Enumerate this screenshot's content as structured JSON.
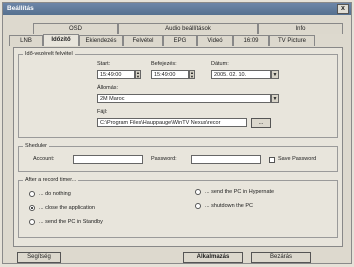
{
  "window": {
    "title": "Beállítás",
    "close_glyph": "x"
  },
  "tabs_top": [
    "OSD",
    "Audio beállítások",
    "Info"
  ],
  "tabs_bottom": [
    "LNB",
    "Időzítő",
    "Ekiendezés",
    "Felvétel",
    "EPG",
    "Videó",
    "16:09",
    "TV Picture"
  ],
  "timed": {
    "title": "Idő-vezérelt felvétel",
    "start_label": "Start:",
    "start_value": "15:49:00",
    "end_label": "Befejezés:",
    "end_value": "15:49:00",
    "date_label": "Dátum:",
    "date_value": "2005. 02. 10.",
    "station_label": "Állomás:",
    "station_value": "2M Maroc",
    "file_label": "Fájl:",
    "file_value": "C:\\Program Files\\Hauppauge\\WinTV Nexus\\recor",
    "browse_label": "..."
  },
  "scheduler": {
    "title": "Sheduler",
    "account_label": "Account:",
    "account_value": "",
    "password_label": "Password:",
    "password_value": "",
    "save_password_label": "Save Password"
  },
  "after": {
    "title": "After a record timer...",
    "options": [
      "... do nothing",
      "... close the application",
      "... send the PC in Standby",
      "... send the PC in Hypernate",
      "... shutdown the PC"
    ],
    "selected_index": 1
  },
  "buttons": {
    "help": "Segítség",
    "apply": "Alkalmazás",
    "close": "Bezárás"
  }
}
